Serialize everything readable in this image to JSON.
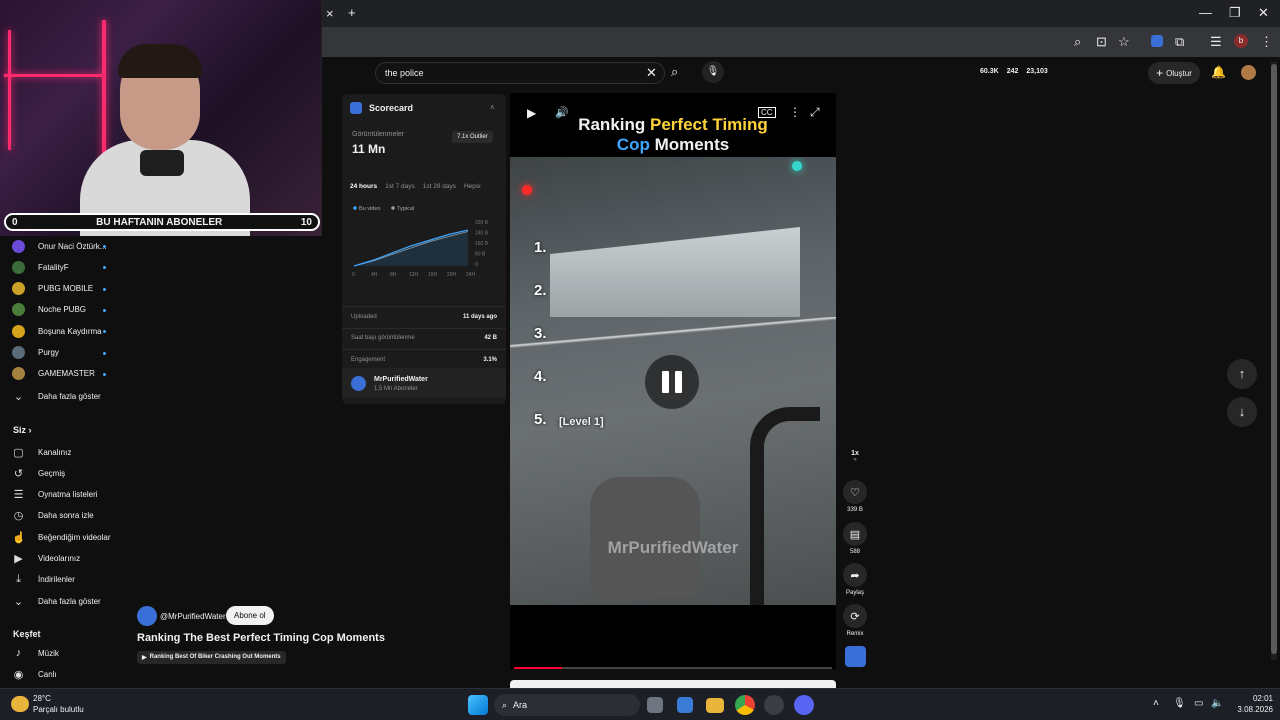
{
  "browser": {
    "tab_close": "×",
    "new_tab": "+"
  },
  "webcam": {
    "subs_label": "BU HAFTANIN ABONELER",
    "subs_left": "0",
    "subs_right": "10"
  },
  "sidebar": {
    "channels": [
      {
        "label": "Onur Naci Öztürk...",
        "color": "#6b4bd8"
      },
      {
        "label": "FatalityF",
        "color": "#3a6b3a"
      },
      {
        "label": "PUBG MOBILE",
        "color": "#c9a227"
      },
      {
        "label": "Noche PUBG",
        "color": "#4a7d3b"
      },
      {
        "label": "Boşuna Kaydırma",
        "color": "#d6a31c"
      },
      {
        "label": "Purgy",
        "color": "#5a6b7a"
      },
      {
        "label": "GAMEMASTER",
        "color": "#a6823f"
      }
    ],
    "show_more_1": "Daha fazla göster",
    "you_heading": "Siz",
    "you_items": [
      {
        "label": "Kanalınız",
        "icon": "user-square-icon",
        "glyph": "▢"
      },
      {
        "label": "Geçmiş",
        "icon": "history-icon",
        "glyph": "↺"
      },
      {
        "label": "Oynatma listeleri",
        "icon": "playlist-icon",
        "glyph": "☰"
      },
      {
        "label": "Daha sonra izle",
        "icon": "clock-icon",
        "glyph": "◷"
      },
      {
        "label": "Beğendiğim videolar",
        "icon": "thumb-up-icon",
        "glyph": "☝"
      },
      {
        "label": "Videolarınız",
        "icon": "video-icon",
        "glyph": "▶"
      },
      {
        "label": "İndirilenler",
        "icon": "download-icon",
        "glyph": "⤓"
      }
    ],
    "show_more_2": "Daha fazla göster",
    "explore_heading": "Keşfet",
    "explore_items": [
      {
        "label": "Müzik",
        "icon": "music-icon",
        "glyph": "♪"
      },
      {
        "label": "Canlı",
        "icon": "live-icon",
        "glyph": "◉"
      }
    ]
  },
  "search": {
    "query": "the police"
  },
  "header": {
    "stat_views": "60.3K",
    "stat_watchers": "242",
    "stat_total": "23,103",
    "create_label": "Oluştur"
  },
  "scorecard": {
    "title": "Scorecard",
    "views_label": "Görüntülenmeler",
    "views_value": "11 Mn",
    "outlier_badge": "7.1x Outlier",
    "tabs": [
      "24 hours",
      "1st 7 days",
      "1st 28 days",
      "Hepsi"
    ],
    "legend_this": "Bu video",
    "legend_typical": "Typical",
    "y_ticks": [
      "320 B",
      "240 B",
      "160 B",
      "80 B",
      "0"
    ],
    "x_ticks": [
      "0",
      "4H",
      "8H",
      "12H",
      "16H",
      "20H",
      "24H"
    ],
    "rows": [
      {
        "label": "Uploaded",
        "value": "11 days ago"
      },
      {
        "label": "Saat başı görüntülenme",
        "value": "42 B"
      },
      {
        "label": "Engagement",
        "value": "3.1%"
      }
    ],
    "channel_name": "MrPurifiedWater",
    "channel_subs": "1,5 Mn Aboneler"
  },
  "chart_data": {
    "type": "line",
    "x": [
      0,
      4,
      8,
      12,
      16,
      20,
      24
    ],
    "ylim": [
      0,
      320
    ],
    "series": [
      {
        "name": "Bu video",
        "values": [
          0,
          40,
          90,
          140,
          180,
          220,
          250
        ]
      },
      {
        "name": "Typical",
        "values": [
          0,
          35,
          80,
          125,
          170,
          205,
          240
        ]
      }
    ],
    "colors": [
      "#3ea6ff",
      "#9a9a9a"
    ]
  },
  "video": {
    "title_line1_a": "Ranking ",
    "title_line1_b": "Perfect Timing",
    "title_line2_a": "Cop",
    "title_line2_b": " Moments",
    "ranks": [
      "1.",
      "2.",
      "3.",
      "4.",
      "5."
    ],
    "rank5_note": "[Level 1]",
    "watermark": "MrPurifiedWater",
    "progress": 0.15
  },
  "meta": {
    "handle": "@MrPurifiedWater",
    "subscribe": "Abone ol",
    "title": "Ranking The Best Perfect Timing Cop Moments",
    "playlist": "Ranking Best Of Biker Crashing Out Moments"
  },
  "actions": {
    "speed": "1x",
    "likes": "339 B",
    "comments": "588",
    "share": "Paylaş",
    "remix": "Remix"
  },
  "taskbar": {
    "temp": "28°C",
    "weather": "Parçalı bulutlu",
    "search_placeholder": "Ara",
    "time": "02:01",
    "date": "3.08.2026"
  }
}
